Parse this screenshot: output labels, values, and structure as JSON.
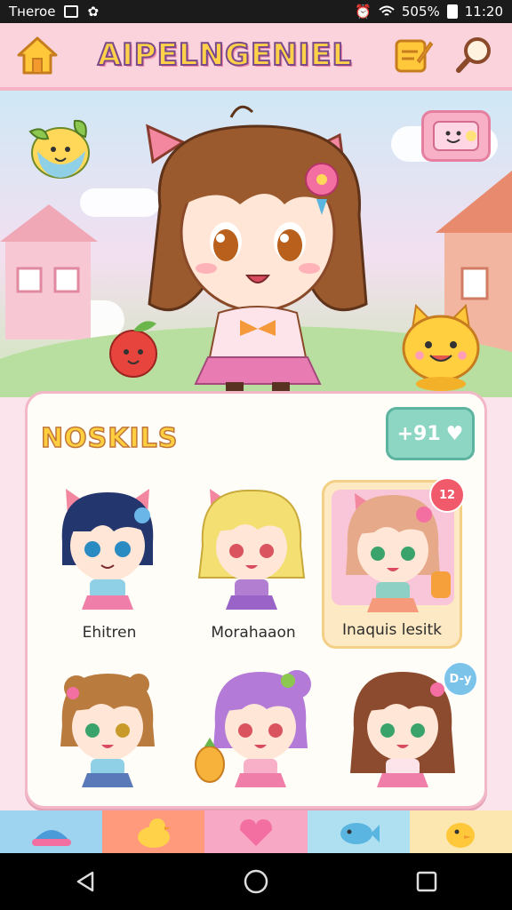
{
  "status_bar": {
    "carrier": "Tнeroe",
    "battery_percent": "505%",
    "time": "11:20"
  },
  "header": {
    "title": "AIPELNGENIEL"
  },
  "panel": {
    "title": "NOSKILS",
    "count_badge": "+91"
  },
  "characters": [
    {
      "label": "Ehitren",
      "hair": "#24366e",
      "cat_ears": true,
      "selected": false,
      "badge": ""
    },
    {
      "label": "Morahaaon",
      "hair": "#f3df72",
      "cat_ears": true,
      "selected": false,
      "badge": ""
    },
    {
      "label": "Inaquis lesitk",
      "hair": "#e6a98a",
      "cat_ears": true,
      "selected": true,
      "badge": "12"
    },
    {
      "label": "",
      "hair": "#b97b3e",
      "cat_ears": false,
      "selected": false,
      "badge": ""
    },
    {
      "label": "",
      "hair": "#b37ad7",
      "cat_ears": false,
      "selected": false,
      "badge": ""
    },
    {
      "label": "",
      "hair": "#8c4a2f",
      "cat_ears": false,
      "selected": false,
      "badge": "D-y"
    }
  ],
  "colors": {
    "topbar": "#fbd3dd",
    "accent_pink": "#f3b3c4",
    "title_yellow": "#ffd24a",
    "panel_bg": "#fffdf8"
  },
  "icons": {
    "home": "home-icon",
    "edit": "edit-note-icon",
    "search": "search-icon"
  }
}
